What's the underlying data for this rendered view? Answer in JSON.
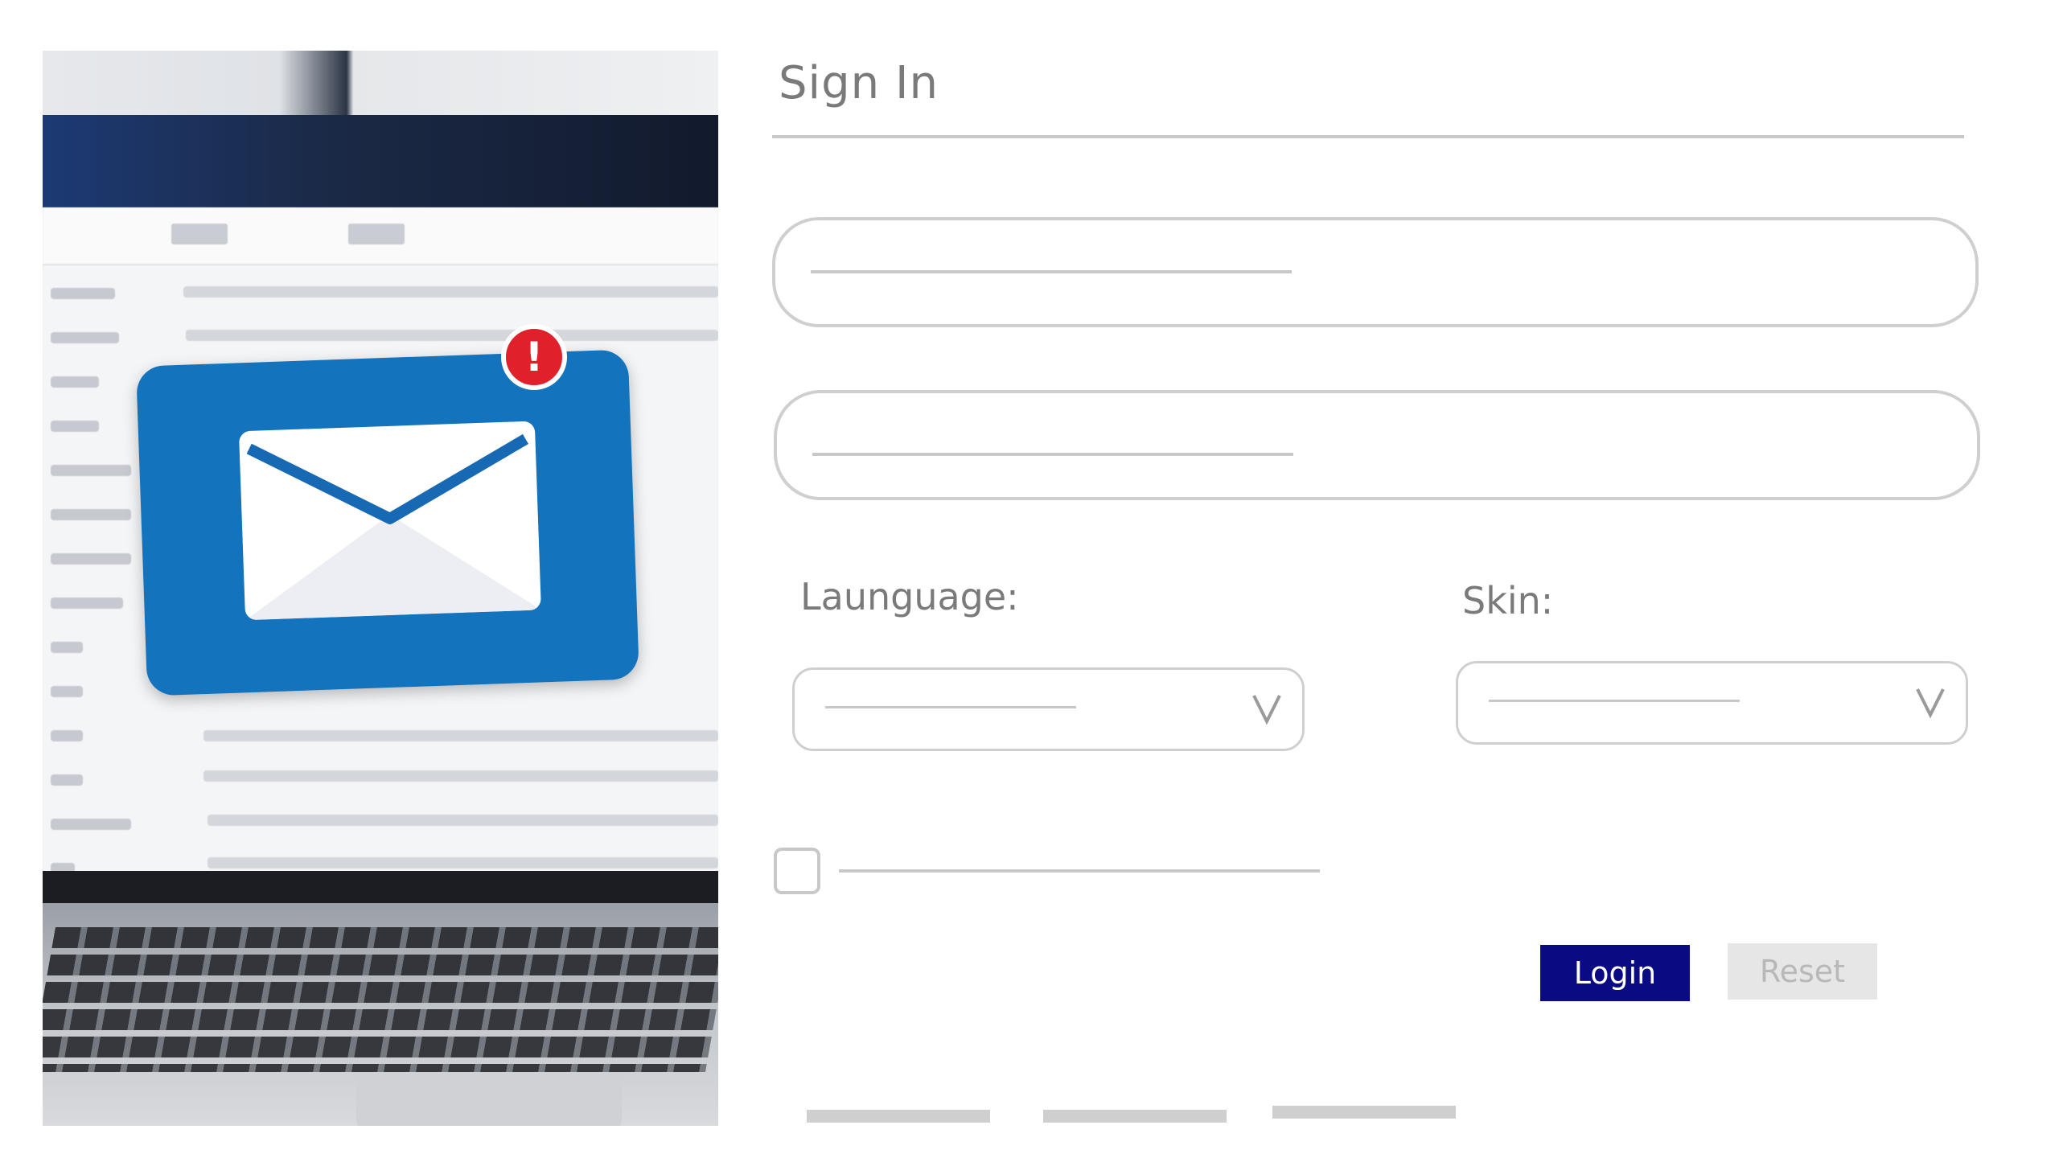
{
  "page": {
    "title": "Sign In"
  },
  "form": {
    "username_value": "",
    "password_value": "",
    "language_label": "Launguage:",
    "language_selected": "",
    "skin_label": "Skin:",
    "skin_selected": "",
    "remember_checked": false
  },
  "buttons": {
    "login_label": "Login",
    "reset_label": "Reset"
  },
  "hero": {
    "alert_symbol": "!",
    "icons": [
      "mail-icon",
      "alert-badge-icon"
    ]
  },
  "colors": {
    "login_bg": "#0a0a82",
    "reset_bg": "#e6e6e6",
    "mail_card": "#1473bd",
    "alert": "#e0202a",
    "placeholder_gray": "#c8c8c8"
  }
}
